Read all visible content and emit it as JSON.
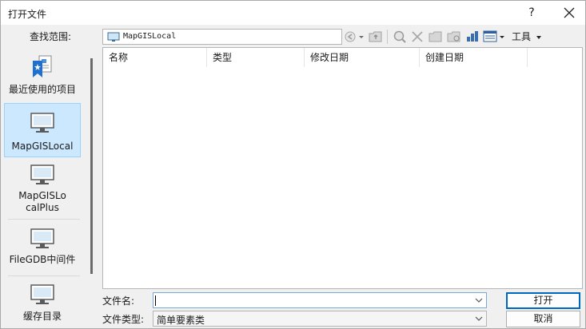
{
  "window": {
    "title": "打开文件",
    "help": "?"
  },
  "lookin": {
    "label": "查找范围:",
    "value": "MapGISLocal"
  },
  "toolbar": {
    "tools_label": "工具"
  },
  "places": [
    {
      "label": "最近使用的项目",
      "icon": "recent-items-icon"
    },
    {
      "label": "MapGISLocal",
      "icon": "monitor-icon"
    },
    {
      "label": "MapGISLo\ncalPlus",
      "icon": "monitor-icon"
    },
    {
      "label": "FileGDB中间件",
      "icon": "monitor-icon"
    },
    {
      "label": "缓存目录",
      "icon": "monitor-icon"
    }
  ],
  "columns": [
    "名称",
    "类型",
    "修改日期",
    "创建日期"
  ],
  "filename": {
    "label": "文件名:",
    "value": ""
  },
  "filetype": {
    "label": "文件类型:",
    "value": "简单要素类"
  },
  "buttons": {
    "open": "打开",
    "cancel": "取消"
  },
  "colors": {
    "selection": "#cce8ff",
    "selection_border": "#99d1ff",
    "accent": "#0067c0"
  }
}
